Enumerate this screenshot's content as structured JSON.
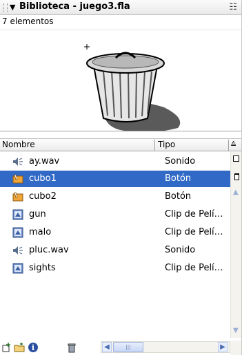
{
  "panel": {
    "title": "Biblioteca - juego3.fla",
    "item_count": "7 elementos"
  },
  "list": {
    "columns": {
      "name": "Nombre",
      "type": "Tipo"
    },
    "items": [
      {
        "name": "ay.wav",
        "type": "Sonido",
        "icon": "sound-icon",
        "selected": false
      },
      {
        "name": "cubo1",
        "type": "Botón",
        "icon": "button-symbol-icon",
        "selected": true
      },
      {
        "name": "cubo2",
        "type": "Botón",
        "icon": "button-symbol-icon",
        "selected": false
      },
      {
        "name": "gun",
        "type": "Clip de Pelí…",
        "icon": "movieclip-icon",
        "selected": false
      },
      {
        "name": "malo",
        "type": "Clip de Pelí…",
        "icon": "movieclip-icon",
        "selected": false
      },
      {
        "name": "pluc.wav",
        "type": "Sonido",
        "icon": "sound-icon",
        "selected": false
      },
      {
        "name": "sights",
        "type": "Clip de Pelí…",
        "icon": "movieclip-icon",
        "selected": false
      }
    ]
  },
  "colors": {
    "selection": "#3169c6",
    "header_bg": "#ececec"
  }
}
